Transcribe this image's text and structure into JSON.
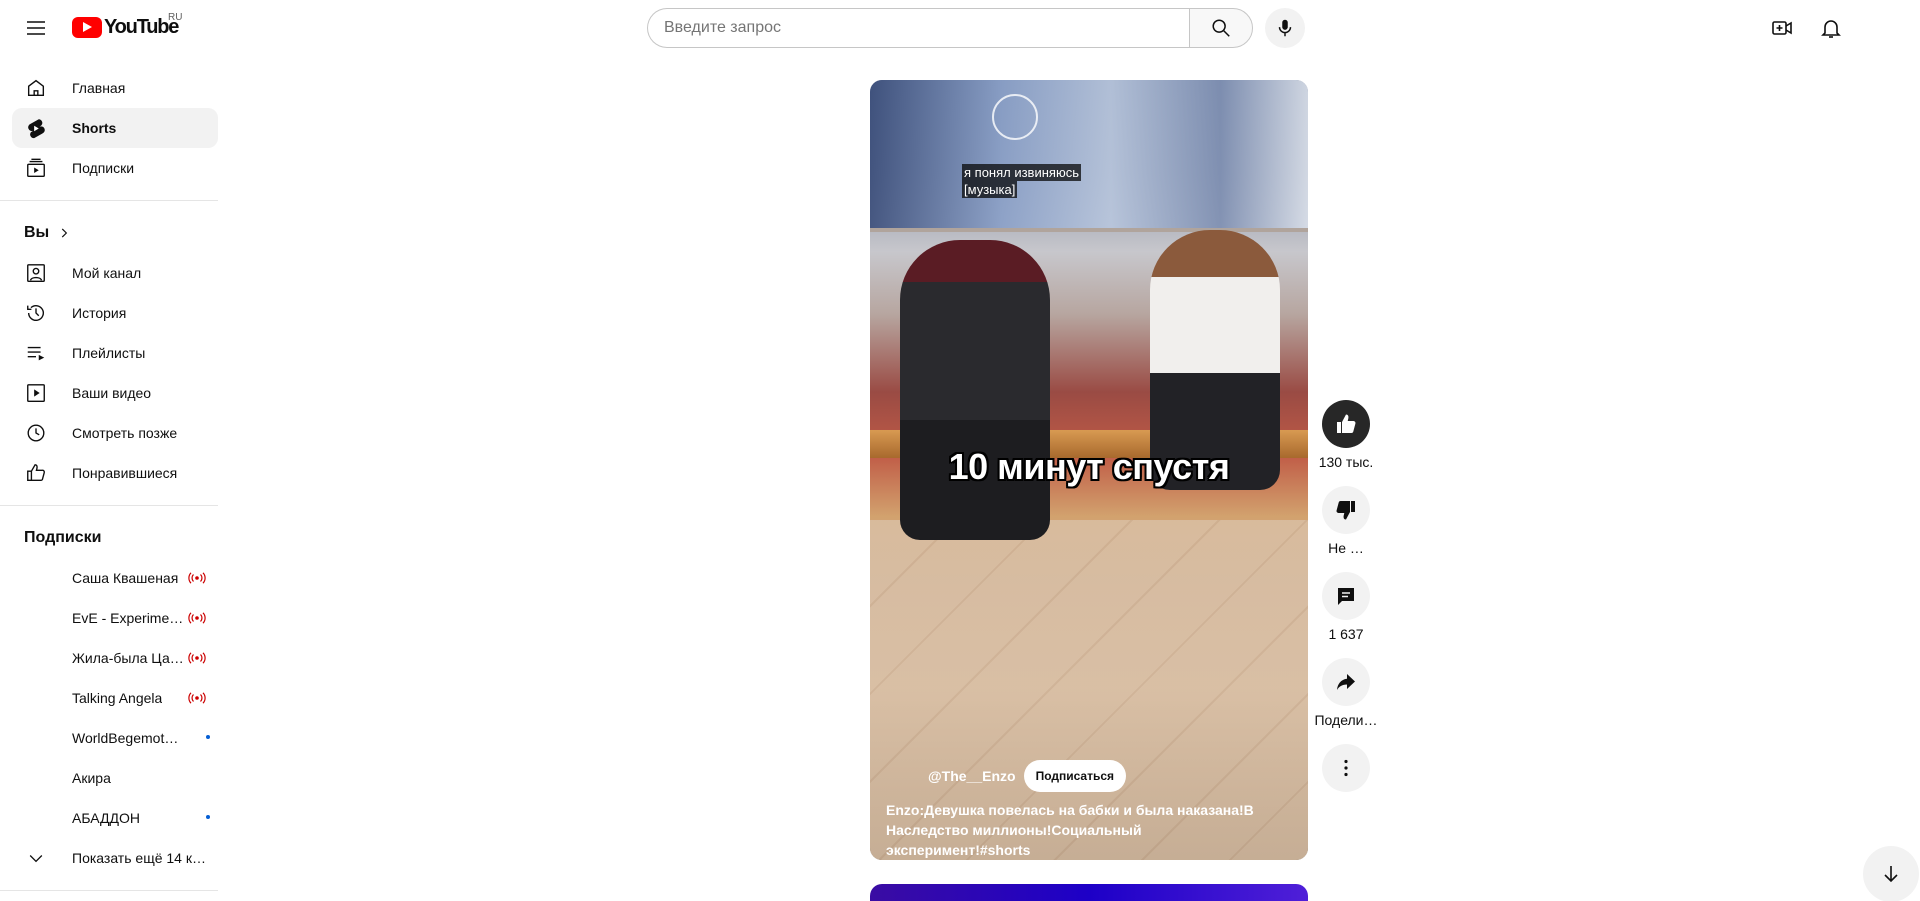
{
  "header": {
    "logo_text": "YouTube",
    "region": "RU",
    "search_placeholder": "Введите запрос"
  },
  "sidebar": {
    "main": [
      {
        "label": "Главная",
        "icon": "home-icon"
      },
      {
        "label": "Shorts",
        "icon": "shorts-icon",
        "active": true
      },
      {
        "label": "Подписки",
        "icon": "subscriptions-icon"
      }
    ],
    "you_title": "Вы",
    "you": [
      {
        "label": "Мой канал",
        "icon": "channel-icon"
      },
      {
        "label": "История",
        "icon": "history-icon"
      },
      {
        "label": "Плейлисты",
        "icon": "playlists-icon"
      },
      {
        "label": "Ваши видео",
        "icon": "your-videos-icon"
      },
      {
        "label": "Смотреть позже",
        "icon": "watch-later-icon"
      },
      {
        "label": "Понравившиеся",
        "icon": "liked-icon"
      }
    ],
    "subs_title": "Подписки",
    "subscriptions": [
      {
        "label": "Саша Квашеная",
        "badge": "live"
      },
      {
        "label": "EvE - Experiment…",
        "badge": "live"
      },
      {
        "label": "Жила-была Цар…",
        "badge": "live"
      },
      {
        "label": "Talking Angela",
        "badge": "live"
      },
      {
        "label": "WorldBegemotK…",
        "badge": "dot"
      },
      {
        "label": "Акира",
        "badge": ""
      },
      {
        "label": "АБАДДОН",
        "badge": "dot"
      }
    ],
    "show_more": "Показать ещё 14 к…"
  },
  "player": {
    "caption_line1": "я понял извиняюсь",
    "caption_line2": "[музыка]",
    "overlay_text": "10 минут спустя",
    "channel": "@The__Enzo",
    "subscribe_label": "Подписаться",
    "title": "Enzo:Девушка повелась на бабки и была наказана!В Наследство миллионы!Социальный эксперимент!#shorts"
  },
  "actions": {
    "like_count": "130 тыс.",
    "dislike_label": "Не …",
    "comments_count": "1 637",
    "share_label": "Подели…"
  },
  "colors": {
    "brand_red": "#ff0000",
    "live_red": "#cc0000",
    "new_dot_blue": "#065fd4"
  }
}
